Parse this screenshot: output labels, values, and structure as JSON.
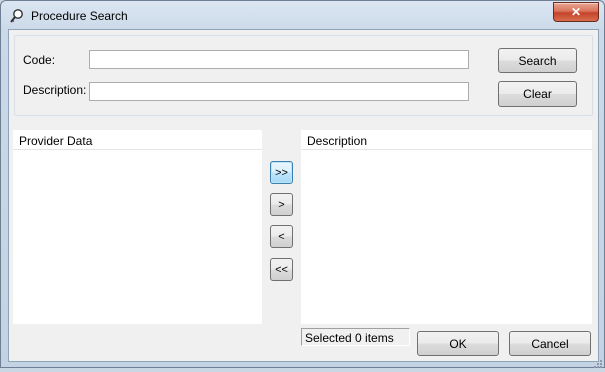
{
  "window": {
    "title": "Procedure Search",
    "close_label": "✕"
  },
  "search": {
    "code_label": "Code:",
    "code_value": "",
    "description_label": "Description:",
    "description_value": "",
    "search_button": "Search",
    "clear_button": "Clear"
  },
  "left_list": {
    "header": "Provider Data",
    "items": []
  },
  "right_list": {
    "header": "Description",
    "items": []
  },
  "transfer_buttons": {
    "add_all": ">>",
    "add": ">",
    "remove": "<",
    "remove_all": "<<"
  },
  "status": {
    "selected_text": "Selected 0 items"
  },
  "footer": {
    "ok_button": "OK",
    "cancel_button": "Cancel"
  },
  "icons": {
    "app": "magnifier-key-icon",
    "close": "close-icon"
  },
  "colors": {
    "close_button": "#c5432a",
    "focus_border": "#3c7fb1"
  }
}
